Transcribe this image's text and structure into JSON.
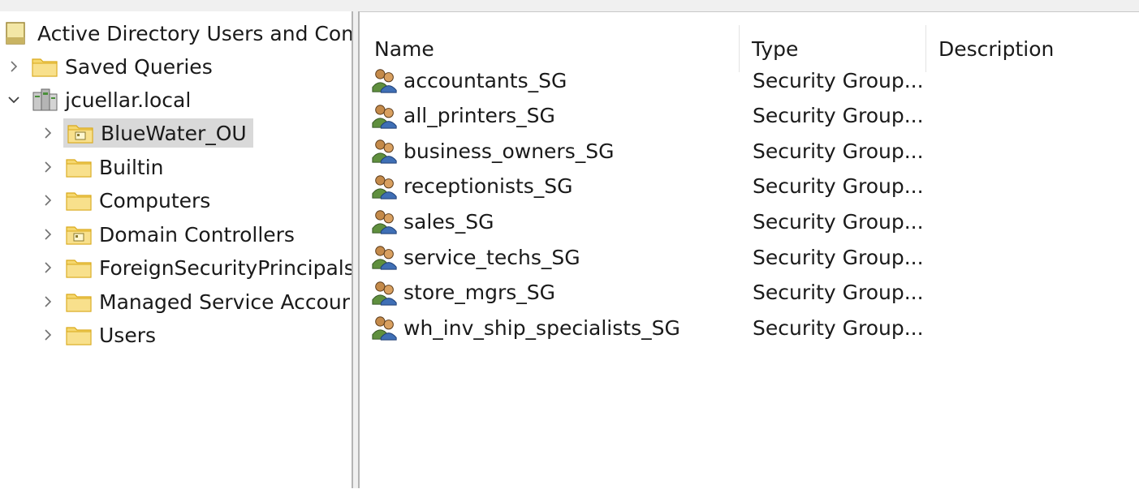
{
  "tree": {
    "root": {
      "label": "Active Directory Users and Com",
      "icon": "aduc-console-icon"
    },
    "items": [
      {
        "label": "Saved Queries",
        "icon": "folder-icon",
        "chevron": "right",
        "indent": 1
      },
      {
        "label": "jcuellar.local",
        "icon": "domain-icon",
        "chevron": "down",
        "indent": 1
      },
      {
        "label": "BlueWater_OU",
        "icon": "ou-folder-icon",
        "chevron": "right",
        "indent": 2,
        "selected": true
      },
      {
        "label": "Builtin",
        "icon": "folder-icon",
        "chevron": "right",
        "indent": 2
      },
      {
        "label": "Computers",
        "icon": "folder-icon",
        "chevron": "right",
        "indent": 2
      },
      {
        "label": "Domain Controllers",
        "icon": "ou-folder-icon",
        "chevron": "right",
        "indent": 2
      },
      {
        "label": "ForeignSecurityPrincipals",
        "icon": "folder-icon",
        "chevron": "right",
        "indent": 2
      },
      {
        "label": "Managed Service Accour",
        "icon": "folder-icon",
        "chevron": "right",
        "indent": 2
      },
      {
        "label": "Users",
        "icon": "folder-icon",
        "chevron": "right",
        "indent": 2
      }
    ]
  },
  "list": {
    "columns": [
      "Name",
      "Type",
      "Description"
    ],
    "rows": [
      {
        "name": "accountants_SG",
        "type": "Security Group...",
        "description": ""
      },
      {
        "name": "all_printers_SG",
        "type": "Security Group...",
        "description": ""
      },
      {
        "name": "business_owners_SG",
        "type": "Security Group...",
        "description": ""
      },
      {
        "name": "receptionists_SG",
        "type": "Security Group...",
        "description": ""
      },
      {
        "name": "sales_SG",
        "type": "Security Group...",
        "description": ""
      },
      {
        "name": "service_techs_SG",
        "type": "Security Group...",
        "description": ""
      },
      {
        "name": "store_mgrs_SG",
        "type": "Security Group...",
        "description": ""
      },
      {
        "name": "wh_inv_ship_specialists_SG",
        "type": "Security Group...",
        "description": ""
      }
    ],
    "row_icon": "security-group-icon"
  },
  "colors": {
    "selection": "#d9d9d9",
    "folder": "#f5d76e",
    "folder_dark": "#d9a91a"
  }
}
